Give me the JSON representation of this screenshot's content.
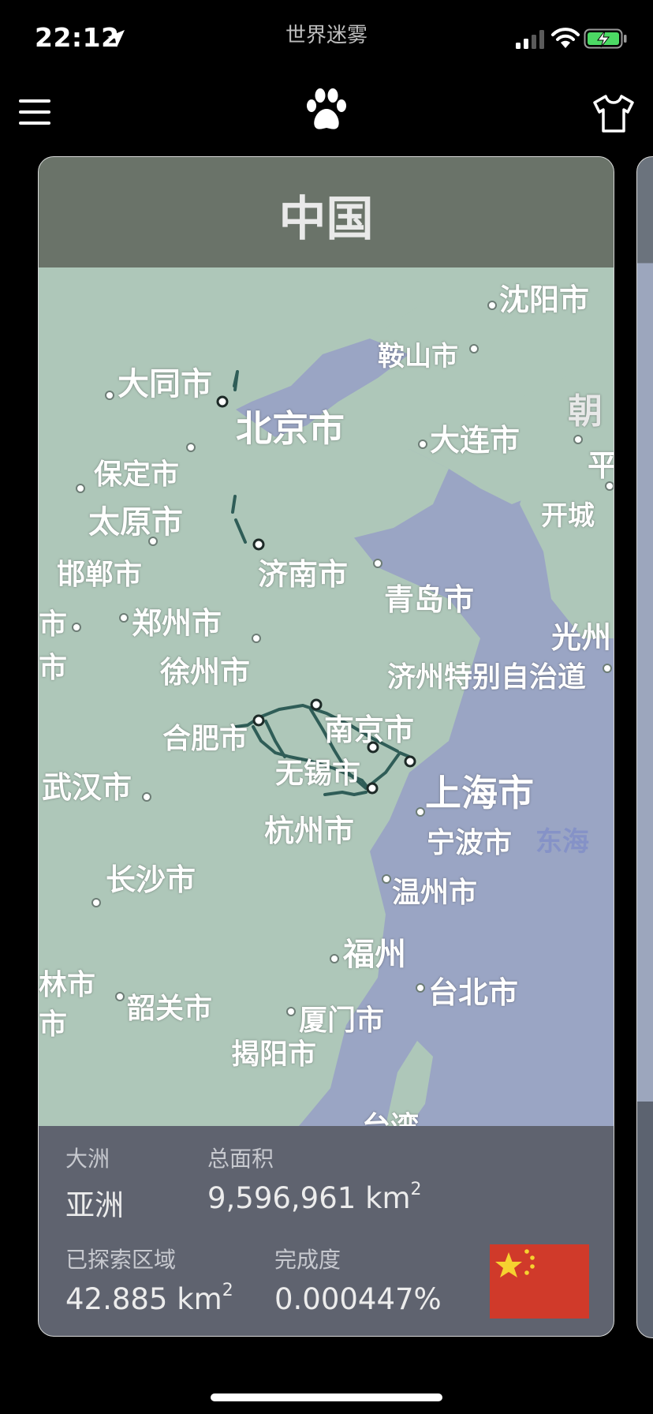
{
  "status_bar": {
    "time": "22:12",
    "app_name": "世界迷雾"
  },
  "nav": {
    "menu_icon": "hamburger-menu-icon",
    "center_icon": "paw-icon",
    "right_icon": "t-shirt-icon"
  },
  "card": {
    "title": "中国",
    "map_labels": {
      "shenyang": "沈阳市",
      "anshan": "鞍山市",
      "datong": "大同市",
      "beijing": "北京市",
      "dalian": "大连市",
      "chao": "朝",
      "ping": "平",
      "baoding": "保定市",
      "kaesong": "开城",
      "taiyuan": "太原市",
      "handan": "邯郸市",
      "jinan": "济南市",
      "qingdao": "青岛市",
      "shi_left": "市",
      "zhengzhou": "郑州市",
      "guangzhou_kr": "光州",
      "shi_left2": "市",
      "xuzhou": "徐州市",
      "jeju": "济州特别自治道",
      "nanjing": "南京市",
      "hefei": "合肥市",
      "wuxi": "无锡市",
      "wuhan": "武汉市",
      "shanghai": "上海市",
      "hangzhou": "杭州市",
      "ningbo": "宁波市",
      "donghai": "东海",
      "changsha": "长沙市",
      "wenzhou": "温州市",
      "fuzhou": "福州",
      "lin": "林市",
      "taipei": "台北市",
      "shaoguan": "韶关市",
      "xiamen": "厦门市",
      "shi_left3": "市",
      "jieyang": "揭阳市",
      "taiwan": "台湾"
    },
    "footer": {
      "continent_label": "大洲",
      "continent_value": "亚洲",
      "area_label": "总面积",
      "area_value": "9,596,961 km",
      "area_sup": "2",
      "explored_label": "已探索区域",
      "explored_value": "42.885 km",
      "explored_sup": "2",
      "completion_label": "完成度",
      "completion_value": "0.000447%"
    },
    "flag": "china-flag"
  },
  "colors": {
    "land": "#aec7b9",
    "sea": "#9aa5c4",
    "track": "#2f5d57",
    "header": "#6a7369",
    "footer": "#5f636f",
    "flag_red": "#d03a2a",
    "flag_star": "#f6d230"
  }
}
